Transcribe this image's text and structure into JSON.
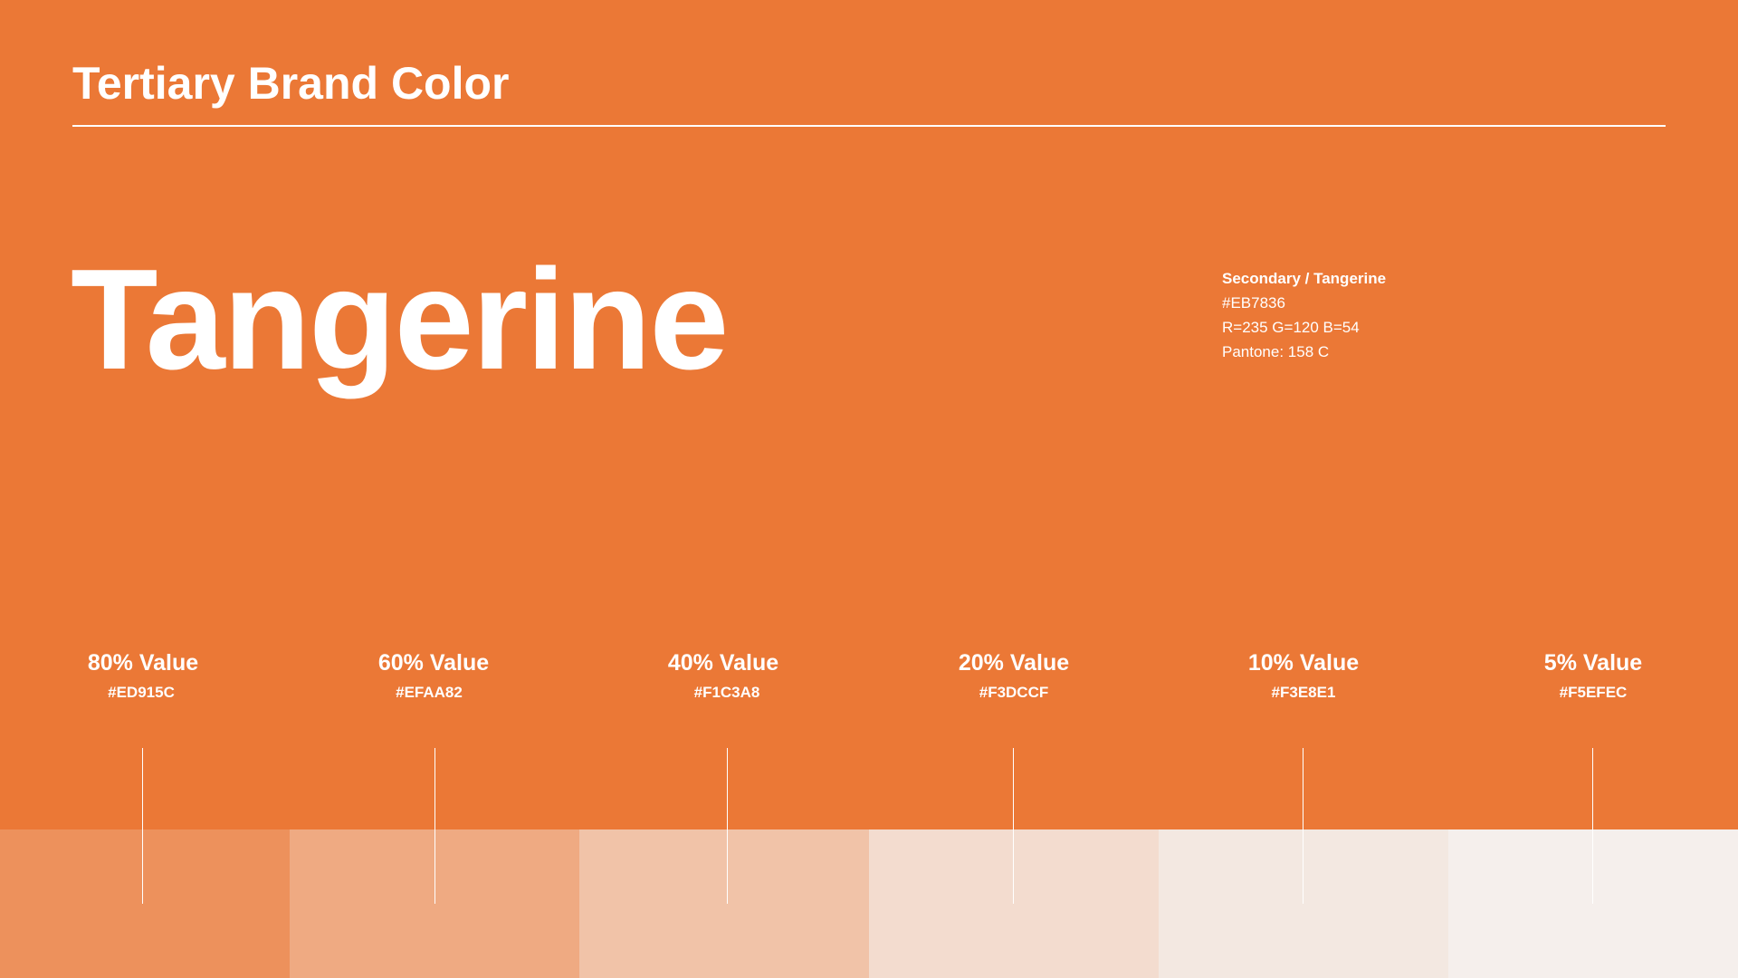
{
  "header": {
    "title": "Tertiary Brand Color"
  },
  "hero": {
    "name": "Tangerine"
  },
  "spec": {
    "label": "Secondary / Tangerine",
    "hex": "#EB7836",
    "rgb": "R=235 G=120 B=54",
    "pantone": "Pantone: 158 C"
  },
  "colors": {
    "base": "#EB7836",
    "text": "#FFFFFF"
  },
  "tints": [
    {
      "label": "80% Value",
      "hex": "#ED915C",
      "color": "#ED915C"
    },
    {
      "label": "60% Value",
      "hex": "#EFAA82",
      "color": "#EFAA82"
    },
    {
      "label": "40% Value",
      "hex": "#F1C3A8",
      "color": "#F1C3A8"
    },
    {
      "label": "20% Value",
      "hex": "#F3DCCF",
      "color": "#F3DCCF"
    },
    {
      "label": "10% Value",
      "hex": "#F3E8E1",
      "color": "#F3E8E1"
    },
    {
      "label": "5% Value",
      "hex": "#F5EFEC",
      "color": "#F5EFEC"
    }
  ]
}
